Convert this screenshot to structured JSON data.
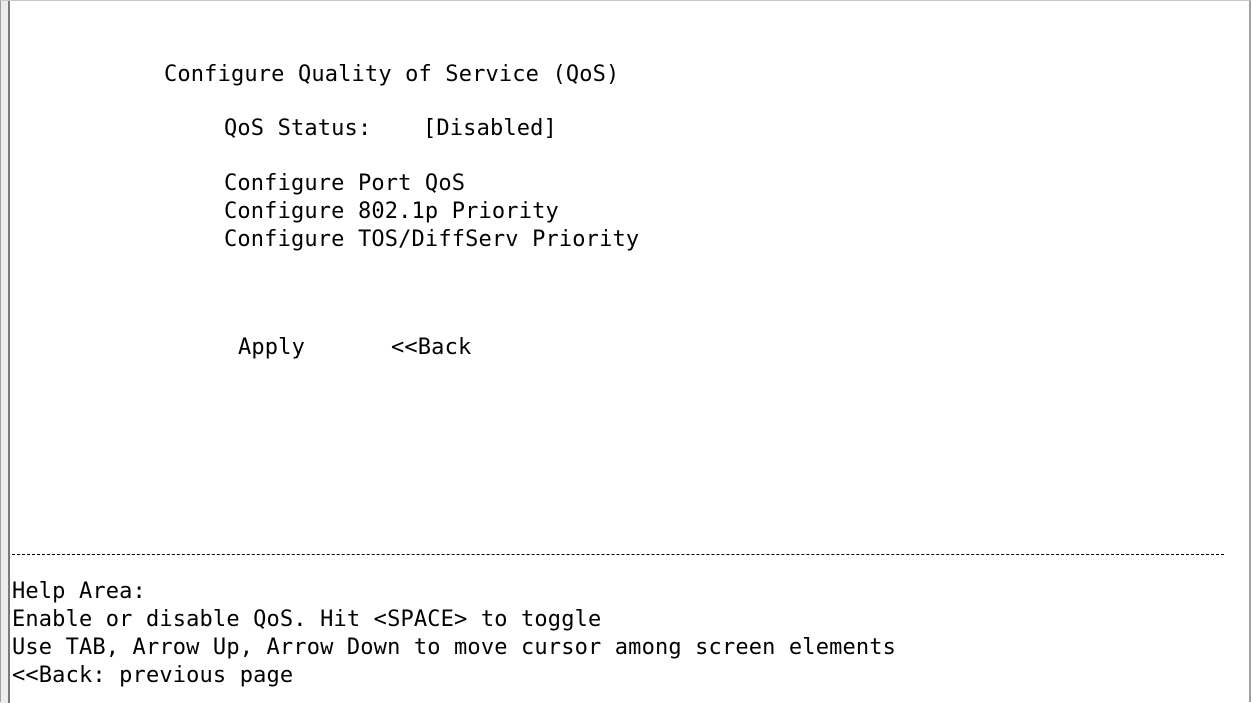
{
  "screen": {
    "title": "Configure Quality of Service (QoS)",
    "qos_status": {
      "label": "QoS Status:",
      "value": "[Disabled]"
    },
    "menu": [
      {
        "label": "Configure Port QoS"
      },
      {
        "label": "Configure 802.1p Priority"
      },
      {
        "label": "Configure TOS/DiffServ Priority"
      }
    ],
    "buttons": {
      "apply": "Apply",
      "back": "<<Back"
    },
    "divider": "----------------------------------------------------------------------------------------------------------------",
    "help": {
      "title": "Help Area:",
      "lines": [
        "Enable or disable QoS. Hit <SPACE> to toggle",
        "Use TAB, Arrow Up, Arrow Down to move cursor among screen elements",
        "<<Back: previous page"
      ]
    }
  }
}
